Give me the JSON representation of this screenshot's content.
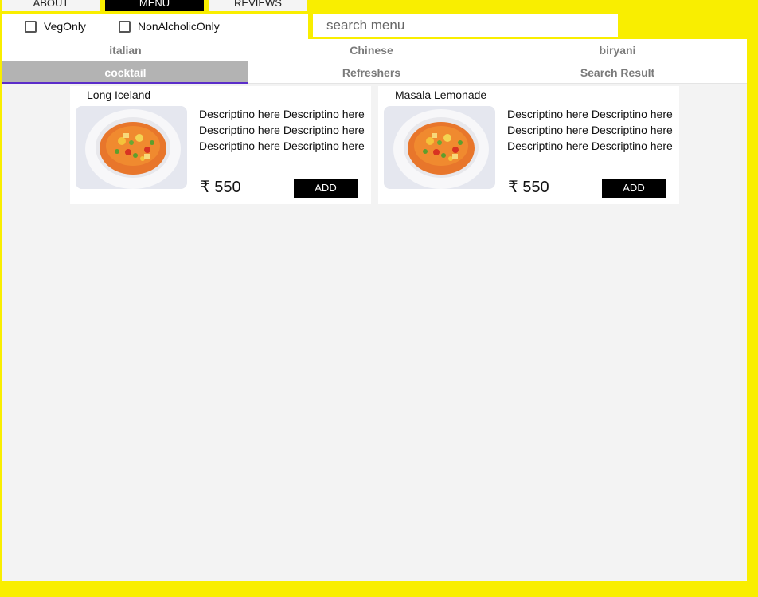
{
  "nav": {
    "tabs": [
      {
        "label": "ABOUT"
      },
      {
        "label": "MENU"
      },
      {
        "label": "REVIEWS"
      }
    ],
    "active_tab": "MENU"
  },
  "filters": {
    "veg_only": {
      "label": "VegOnly",
      "checked": false
    },
    "non_alcoholic_only": {
      "label": "NonAlcholicOnly",
      "checked": false
    }
  },
  "search": {
    "placeholder": "search menu",
    "value": ""
  },
  "categories": {
    "items": [
      {
        "label": "italian"
      },
      {
        "label": "Chinese"
      },
      {
        "label": "biryani"
      },
      {
        "label": "cocktail"
      },
      {
        "label": "Refreshers"
      },
      {
        "label": "Search Result"
      }
    ],
    "active": "cocktail"
  },
  "menu_items": [
    {
      "name": "Long Iceland",
      "description": "Descriptino here Descriptino here Descriptino here Descriptino here Descriptino here Descriptino here",
      "price": "₹ 550",
      "add_label": "ADD",
      "image_icon": "soup-bowl-photo"
    },
    {
      "name": "Masala Lemonade",
      "description": "Descriptino here Descriptino here Descriptino here Descriptino here Descriptino here Descriptino here",
      "price": "₹ 550",
      "add_label": "ADD",
      "image_icon": "soup-bowl-photo"
    }
  ],
  "colors": {
    "background": "#f9ee00",
    "active_tab": "#000000",
    "active_category": "#b3b3b3",
    "active_indicator": "#5b2dc9"
  }
}
